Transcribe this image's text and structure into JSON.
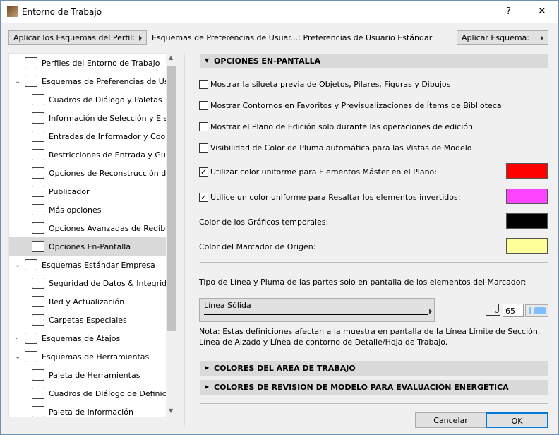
{
  "window": {
    "title": "Entorno de Trabajo",
    "help": "?",
    "close": "✕"
  },
  "toolbar": {
    "apply_profile": "Aplicar los Esquemas del Perfil:",
    "path": "Esquemas de Preferencias de Usuar...: Preferencias de Usuario Estándar",
    "apply_scheme": "Aplicar Esquema:"
  },
  "tree": [
    {
      "label": "Perfiles del Entorno de Trabajo",
      "level": 0,
      "chev": ""
    },
    {
      "label": "Esquemas de Preferencias de Usuario",
      "level": 0,
      "chev": "v"
    },
    {
      "label": "Cuadros de Diálogo y Paletas",
      "level": 1
    },
    {
      "label": "Información de Selección y Elementos",
      "level": 1
    },
    {
      "label": "Entradas de Informador y Coordenadas",
      "level": 1
    },
    {
      "label": "Restricciones de Entrada y Guías",
      "level": 1
    },
    {
      "label": "Opciones de Reconstrucción del Modelo",
      "level": 1
    },
    {
      "label": "Publicador",
      "level": 1
    },
    {
      "label": "Más opciones",
      "level": 1
    },
    {
      "label": "Opciones Avanzadas de Redibujado",
      "level": 1
    },
    {
      "label": "Opciones En-Pantalla",
      "level": 1,
      "selected": true
    },
    {
      "label": "Esquemas Estándar Empresa",
      "level": 0,
      "chev": "v"
    },
    {
      "label": "Seguridad de Datos & Integridad",
      "level": 1
    },
    {
      "label": "Red y Actualización",
      "level": 1
    },
    {
      "label": "Carpetas Especiales",
      "level": 1
    },
    {
      "label": "Esquemas de Atajos",
      "level": 0,
      "chev": ">"
    },
    {
      "label": "Esquemas de Herramientas",
      "level": 0,
      "chev": "v"
    },
    {
      "label": "Paleta de Herramientas",
      "level": 1
    },
    {
      "label": "Cuadros de Diálogo de Definición",
      "level": 1
    },
    {
      "label": "Paleta de Información",
      "level": 1
    }
  ],
  "main": {
    "section_title": "OPCIONES EN-PANTALLA",
    "options": [
      {
        "label": "Mostrar la silueta previa de Objetos, Pilares, Figuras y Dibujos",
        "checked": false
      },
      {
        "label": "Mostrar Contornos en Favoritos y Previsualizaciones de Ítems de Biblioteca",
        "checked": false
      },
      {
        "label": "Mostrar el Plano de Edición solo durante las operaciones de edición",
        "checked": false
      },
      {
        "label": "Visibilidad de Color de Pluma automática para las Vistas de Modelo",
        "checked": false
      },
      {
        "label": "Utilizar color uniforme para Elementos Máster en el Plano:",
        "checked": true,
        "color": "#ff0000"
      },
      {
        "label": "Utilice un color uniforme para Resaltar los elementos invertidos:",
        "checked": true,
        "color": "#ff44ff"
      }
    ],
    "colors": [
      {
        "label": "Color de los Gráficos temporales:",
        "color": "#000000"
      },
      {
        "label": "Color del Marcador de Origen:",
        "color": "#ffff99"
      }
    ],
    "linetype_label": "Tipo de Línea y Pluma de las partes solo en pantalla de los elementos del Marcador:",
    "linetype": "Línea Sólida",
    "pen": "65",
    "pen_color": "#7fbfff",
    "note": "Nota: Estas definiciones afectan a la muestra en pantalla de la Línea Límite de Sección, Línea de Alzado y Línea de contorno de Detalle/Hoja de Trabajo.",
    "collapsed": [
      "COLORES DEL ÁREA DE TRABAJO",
      "COLORES DE REVISIÓN DE MODELO PARA EVALUACIÓN ENERGÉTICA"
    ]
  },
  "buttons": {
    "cancel": "Cancelar",
    "ok": "OK"
  }
}
